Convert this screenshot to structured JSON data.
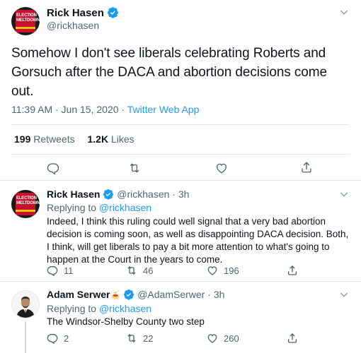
{
  "main_tweet": {
    "author_name": "Rick Hasen",
    "author_handle": "@rickhasen",
    "text": "Somehow I don't see liberals celebrating Roberts and Gorsuch after the DACA and abortion decisions come out.",
    "timestamp": "11:39 AM · Jun 15, 2020 · ",
    "source": "Twitter Web App",
    "retweets_count": "199",
    "retweets_label": "Retweets",
    "likes_count": "1.2K",
    "likes_label": "Likes"
  },
  "replies": [
    {
      "author_name": "Rick Hasen",
      "author_handle": "@rickhasen",
      "time": "3h",
      "replying_prefix": "Replying to",
      "replying_to": "@rickhasen",
      "text": "Indeed, I think this ruling could well signal that a very bad abortion decision is coming soon, as well as disappointing DACA decision. Both, I think, will get liberals to pay a bit more attention to what's going to happen at the Court in the years to come.",
      "reply_count": "11",
      "retweet_count": "46",
      "like_count": "196"
    },
    {
      "author_name": "Adam Serwer",
      "name_emoji": "🍝",
      "author_handle": "@AdamSerwer",
      "time": "3h",
      "replying_prefix": "Replying to",
      "replying_to": "@rickhasen",
      "text": "The Windsor-Shelby County two step",
      "reply_count": "2",
      "retweet_count": "22",
      "like_count": "260"
    }
  ],
  "avatar_book_text": "ELECTION MELTDOWN",
  "icons": [
    "verified-badge-icon",
    "chevron-down-icon",
    "reply-icon",
    "retweet-icon",
    "like-icon",
    "share-icon"
  ],
  "colors": {
    "accent": "#1d9bf0",
    "text": "#0f1419",
    "muted": "#536471",
    "border": "#e1e8ed"
  }
}
